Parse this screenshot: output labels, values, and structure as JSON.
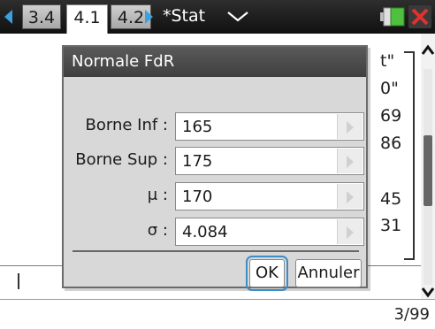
{
  "tabs": [
    {
      "label": "3.4",
      "active": false
    },
    {
      "label": "4.1",
      "active": true
    },
    {
      "label": "4.2",
      "active": false
    }
  ],
  "document": {
    "title": "*Stat"
  },
  "background": {
    "lines": [
      "t\"",
      "0\"",
      "69",
      "86",
      "45",
      "31"
    ]
  },
  "dialog": {
    "title": "Normale FdR",
    "fields": [
      {
        "label": "Borne Inf :",
        "value": "165"
      },
      {
        "label": "Borne Sup :",
        "value": "175"
      },
      {
        "label": "μ :",
        "value": "170"
      },
      {
        "label": "σ :",
        "value": "4.084"
      }
    ],
    "ok_label": "OK",
    "cancel_label": "Annuler"
  },
  "status": {
    "page_counter": "3/99"
  },
  "colors": {
    "accent": "#3aa0e0",
    "close": "#e03030",
    "battery": "#4fc040"
  },
  "icons": [
    "nav-left-arrow-icon",
    "nav-right-arrow-icon",
    "chevron-down-icon",
    "battery-icon",
    "close-icon",
    "scroll-up-icon",
    "scroll-down-icon",
    "field-arrow-icon"
  ]
}
